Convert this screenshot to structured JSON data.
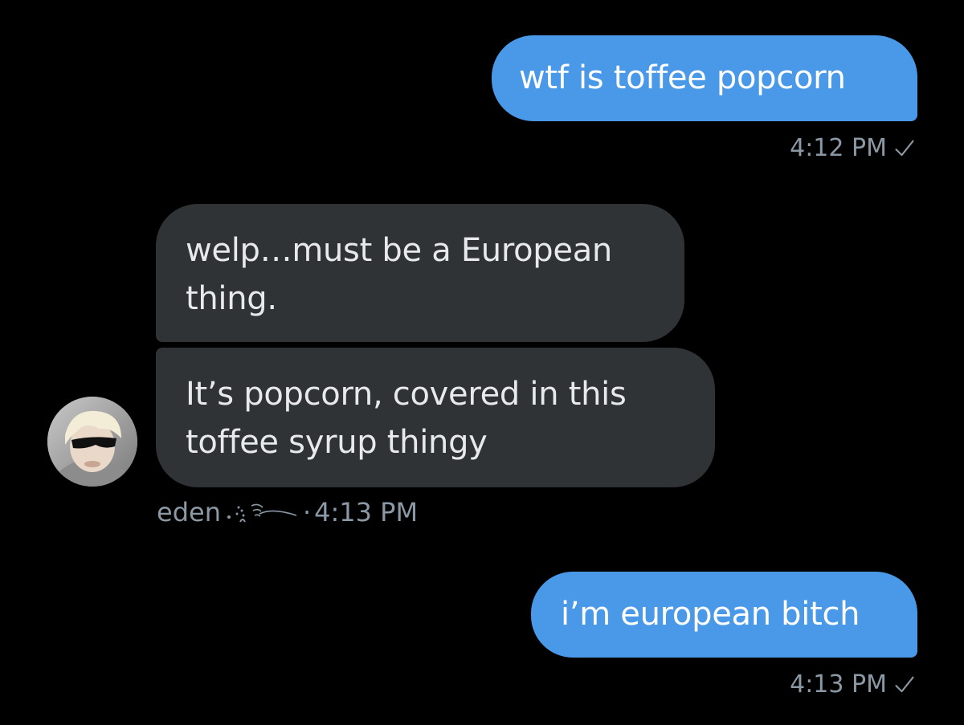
{
  "conversation": {
    "messages": [
      {
        "direction": "outgoing",
        "text": "wtf is toffee popcorn",
        "time": "4:12 PM",
        "status_icon": "check-icon"
      },
      {
        "direction": "incoming",
        "text": "welp…must be a European thing."
      },
      {
        "direction": "incoming",
        "text": "It’s popcorn, covered in this toffee syrup thingy"
      },
      {
        "direction": "outgoing",
        "text": "i’m european bitch",
        "time": "4:13 PM",
        "status_icon": "check-icon"
      }
    ],
    "incoming_meta": {
      "sender_name": "eden",
      "separator": "·",
      "time": "4:13 PM"
    }
  },
  "colors": {
    "background": "#000000",
    "outgoing_bubble": "#4a99e9",
    "incoming_bubble": "#2f3336",
    "meta_text": "#8b98a5"
  }
}
